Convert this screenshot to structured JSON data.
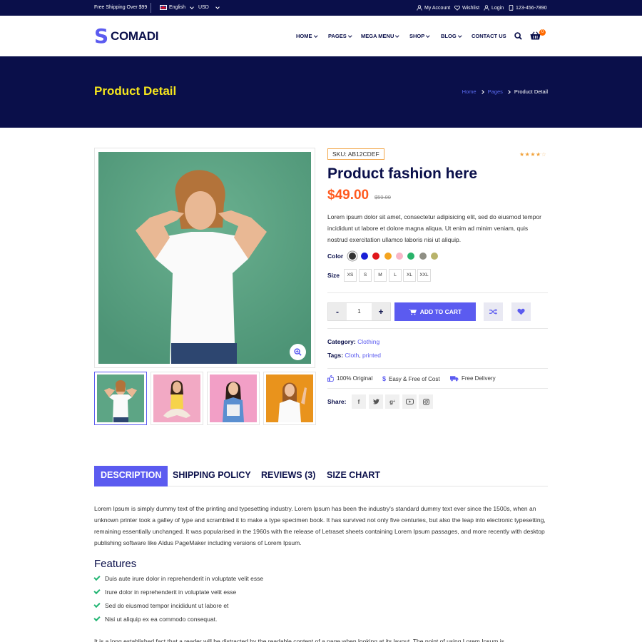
{
  "topbar": {
    "shipping": "Free Shipping Over $99",
    "language": "English",
    "currency": "USD",
    "my_account": "My Account",
    "wishlist": "Wishlist",
    "login": "Login",
    "phone": "123-456-7890"
  },
  "header": {
    "logo_letter": "S",
    "logo_text": "COMADI",
    "nav": [
      "HOME",
      "PAGES",
      "MEGA MENU",
      "SHOP",
      "BLOG",
      "CONTACT US"
    ],
    "cart_count": "0"
  },
  "banner": {
    "title": "Product Detail",
    "breadcrumb": [
      "Home",
      "Pages",
      "Product Detail"
    ]
  },
  "product": {
    "sku": "SKU: AB12CDEF",
    "rating": 4,
    "title": "Product fashion here",
    "price": "$49.00",
    "old_price": "$59.00",
    "description": "Lorem ipsum dolor sit amet, consectetur adipisicing elit, sed do eiusmod tempor incididunt ut labore et dolore magna aliqua. Ut enim ad minim veniam, quis nostrud exercitation ullamco laboris nisi ut aliquip.",
    "color_label": "Color",
    "colors": [
      "#333333",
      "#1a1fd6",
      "#e0161b",
      "#f4a41f",
      "#f7b6c8",
      "#29b36a",
      "#8f8f84",
      "#b8b36a"
    ],
    "size_label": "Size",
    "sizes": [
      "XS",
      "S",
      "M",
      "L",
      "XL",
      "XXL"
    ],
    "quantity": "1",
    "qty_minus": "-",
    "qty_plus": "+",
    "add_to_cart": "ADD TO CART",
    "category_label": "Category:",
    "category": "Clothing",
    "tags_label": "Tags:",
    "tags": [
      "Cloth",
      "printed"
    ],
    "features": [
      "100% Original",
      "Easy & Free of Cost",
      "Free Delivery"
    ],
    "share_label": "Share:",
    "share_icons": [
      "f",
      "t",
      "g+",
      "yt",
      "ig"
    ]
  },
  "tabs": [
    "DESCRIPTION",
    "SHIPPING POLICY",
    "REVIEWS (3)",
    "SIZE CHART"
  ],
  "description": {
    "paragraph": "Lorem Ipsum is simply dummy text of the printing and typesetting industry. Lorem Ipsum has been the industry's standard dummy text ever since the 1500s, when an unknown printer took a galley of type and scrambled it to make a type specimen book. It has survived not only five centuries, but also the leap into electronic typesetting, remaining essentially unchanged. It was popularised in the 1960s with the release of Letraset sheets containing Lorem Ipsum passages, and more recently with desktop publishing software like Aldus PageMaker including versions of Lorem Ipsum.",
    "features_title": "Features",
    "features": [
      "Duis aute irure dolor in reprehenderit in voluptate velit esse",
      "Irure dolor in reprehenderit in voluptate velit esse",
      "Sed do eiusmod tempor incididunt ut labore et",
      "Nisi ut aliquip ex ea commodo consequat."
    ],
    "paragraph2": "It is a long established fact that a reader will be distracted by the readable content of a page when looking at its layout. The point of using Lorem Ipsum is"
  },
  "colors": {
    "navy": "#0a0f4a",
    "accent": "#5b5bf0",
    "price": "#ff5a1f",
    "banner_title": "#f5e51d"
  }
}
